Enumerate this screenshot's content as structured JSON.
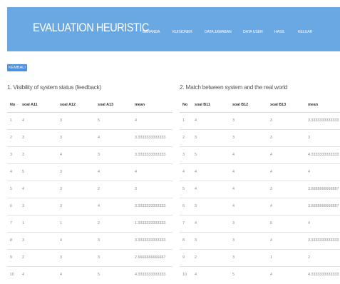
{
  "header": {
    "brand": "EVALUATION HEURISTIC",
    "nav": [
      "BERANDA",
      "KUISIONER",
      "DATA JAWABAN",
      "DATA USER",
      "HASIL",
      "KELUAR"
    ]
  },
  "back_button": "KEMBALI",
  "colors": {
    "navbar": "#6aa8e4",
    "back_button": "#4a90e2"
  },
  "table_a": {
    "title": "1. Visibility of system status (feedback)",
    "headers": [
      "No",
      "soal A11",
      "soal A12",
      "soal A13",
      "mean"
    ],
    "rows": [
      [
        "1",
        "4",
        "3",
        "5",
        "4"
      ],
      [
        "2",
        "3",
        "3",
        "4",
        "3.3333333333333"
      ],
      [
        "3",
        "3",
        "4",
        "3",
        "3.3333333333333"
      ],
      [
        "4",
        "5",
        "3",
        "4",
        "4"
      ],
      [
        "5",
        "4",
        "3",
        "2",
        "3"
      ],
      [
        "6",
        "3",
        "3",
        "4",
        "3.3333333333333"
      ],
      [
        "7",
        "1",
        "1",
        "2",
        "1.3333333333333"
      ],
      [
        "8",
        "3",
        "4",
        "3",
        "3.3333333333333"
      ],
      [
        "9",
        "2",
        "3",
        "3",
        "2.6666666666667"
      ],
      [
        "10",
        "4",
        "4",
        "5",
        "4.3333333333333"
      ]
    ]
  },
  "table_b": {
    "title": "2. Match between system and the real world",
    "headers": [
      "No",
      "soal B11",
      "soal B12",
      "soal B13",
      "mean"
    ],
    "rows": [
      [
        "1",
        "4",
        "3",
        "3",
        "3.3333333333333"
      ],
      [
        "2",
        "3",
        "3",
        "3",
        "3"
      ],
      [
        "3",
        "5",
        "4",
        "4",
        "4.3333333333333"
      ],
      [
        "4",
        "4",
        "4",
        "4",
        "4"
      ],
      [
        "5",
        "4",
        "4",
        "3",
        "3.6666666666667"
      ],
      [
        "6",
        "3",
        "4",
        "4",
        "3.6666666666667"
      ],
      [
        "7",
        "4",
        "3",
        "5",
        "4"
      ],
      [
        "8",
        "3",
        "3",
        "4",
        "3.3333333333333"
      ],
      [
        "9",
        "2",
        "3",
        "1",
        "2"
      ],
      [
        "10",
        "4",
        "5",
        "4",
        "4.3333333333333"
      ]
    ]
  }
}
